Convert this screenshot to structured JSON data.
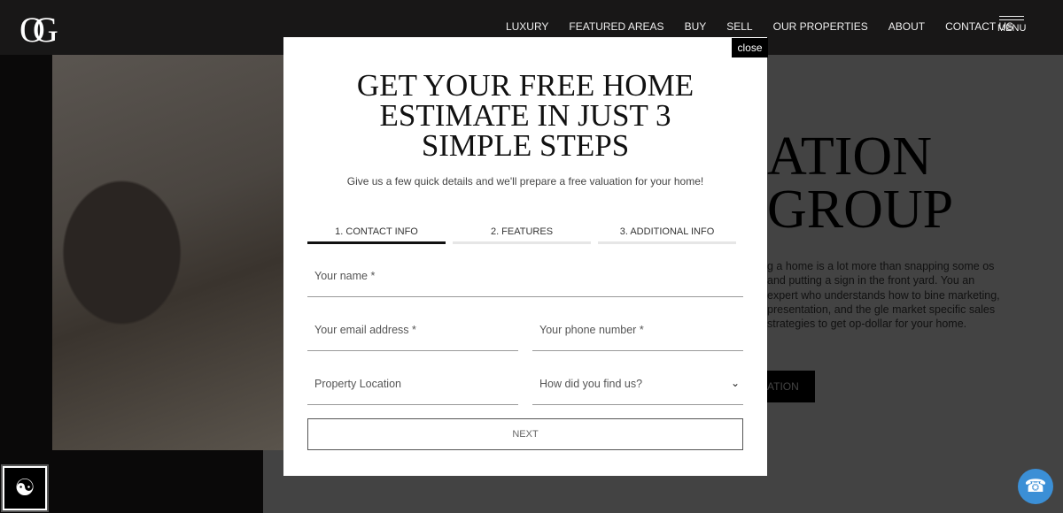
{
  "header": {
    "logo": "OG",
    "nav": [
      "LUXURY",
      "FEATURED AREAS",
      "BUY",
      "SELL",
      "OUR PROPERTIES",
      "ABOUT",
      "CONTACT US"
    ],
    "menu": "MENU"
  },
  "background": {
    "heading_lines": [
      "ATION",
      "GROUP"
    ],
    "paragraph": "g a home is a lot more than snapping some os and putting a sign in the front yard. You an expert who understands how to bine marketing, presentation, and the gle market specific sales strategies to get op-dollar for your home.",
    "button": "ATION"
  },
  "modal": {
    "close": "close",
    "title": "GET YOUR FREE HOME ESTIMATE IN JUST 3 SIMPLE STEPS",
    "subtitle": "Give us a few quick details and we'll prepare a free valuation for your home!",
    "tabs": [
      {
        "label": "1. CONTACT INFO",
        "active": true
      },
      {
        "label": "2. FEATURES",
        "active": false
      },
      {
        "label": "3. ADDITIONAL INFO",
        "active": false
      }
    ],
    "fields": {
      "name": "Your name *",
      "email": "Your email address *",
      "phone": "Your phone number *",
      "location": "Property Location",
      "source": "How did you find us?"
    },
    "next": "NEXT"
  },
  "icons": {
    "accessibility": "accessibility-icon",
    "phone": "phone-icon"
  },
  "colors": {
    "phone_button": "#3b8fd6"
  }
}
